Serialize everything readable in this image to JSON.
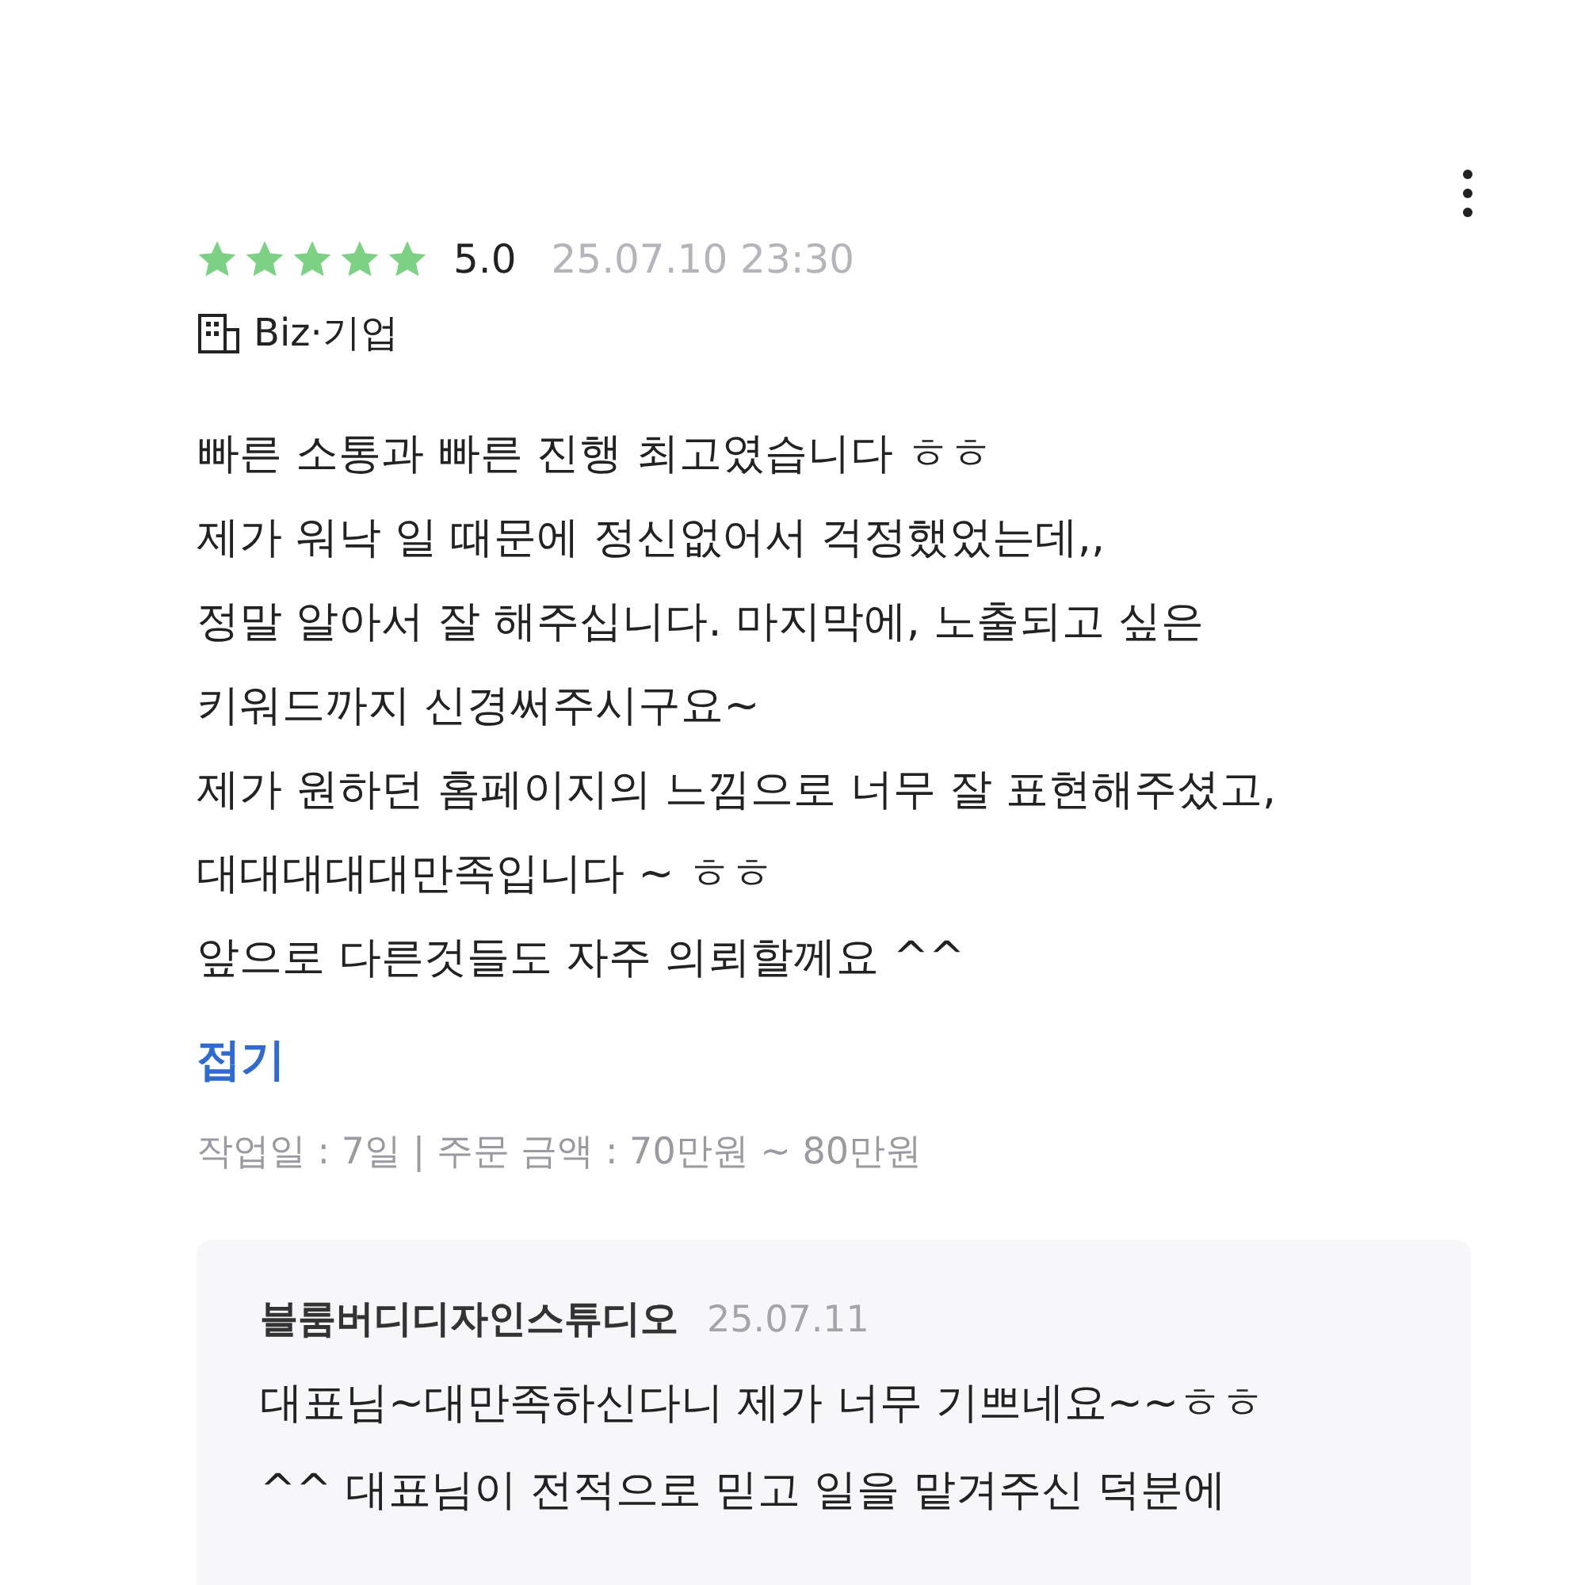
{
  "review": {
    "stars": 5,
    "rating": "5.0",
    "date": "25.07.10 23:30",
    "company_type": "Biz·기업",
    "body": [
      "빠른 소통과 빠른 진행 최고였습니다 ㅎㅎ",
      "제가 워낙 일 때문에 정신없어서 걱정했었는데,,",
      "정말 알아서 잘 해주십니다. 마지막에, 노출되고 싶은",
      "키워드까지 신경써주시구요~",
      "제가 원하던 홈페이지의 느낌으로 너무 잘 표현해주셨고,",
      "대대대대대만족입니다 ~ ㅎㅎ",
      "앞으로 다른것들도 자주 의뢰할께요 ^^"
    ],
    "collapse_link": "접기",
    "meta": "작업일 : 7일 | 주문 금액 : 70만원 ~ 80만원"
  },
  "reply": {
    "author": "블룸버디디자인스튜디오",
    "date": "25.07.11",
    "body": [
      "대표님~대만족하신다니 제가 너무 기쁘네요~~ㅎㅎ",
      "^^ 대표님이 전적으로 믿고 일을 맡겨주신 덕분에"
    ]
  }
}
